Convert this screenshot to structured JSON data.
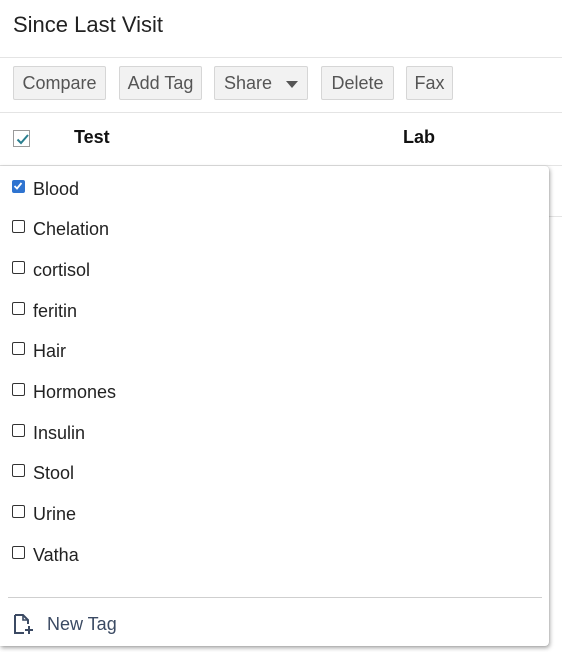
{
  "page": {
    "title": "Since Last Visit"
  },
  "toolbar": {
    "compare_label": "Compare",
    "add_tag_label": "Add Tag",
    "share_label": "Share",
    "delete_label": "Delete",
    "fax_label": "Fax"
  },
  "table": {
    "header_checked": true,
    "columns": [
      "Test",
      "Lab"
    ]
  },
  "tag_menu": {
    "items": [
      {
        "label": "Blood",
        "checked": true
      },
      {
        "label": "Chelation",
        "checked": false
      },
      {
        "label": "cortisol",
        "checked": false
      },
      {
        "label": "feritin",
        "checked": false
      },
      {
        "label": "Hair",
        "checked": false
      },
      {
        "label": "Hormones",
        "checked": false
      },
      {
        "label": "Insulin",
        "checked": false
      },
      {
        "label": "Stool",
        "checked": false
      },
      {
        "label": "Urine",
        "checked": false
      },
      {
        "label": "Vatha",
        "checked": false
      }
    ],
    "new_tag_label": "New Tag",
    "new_tag_icon": "add-document-icon"
  },
  "colors": {
    "checkbox_checked": "#2f74d0",
    "header_check": "#2a7f8f",
    "new_tag_text": "#3b4a63"
  }
}
